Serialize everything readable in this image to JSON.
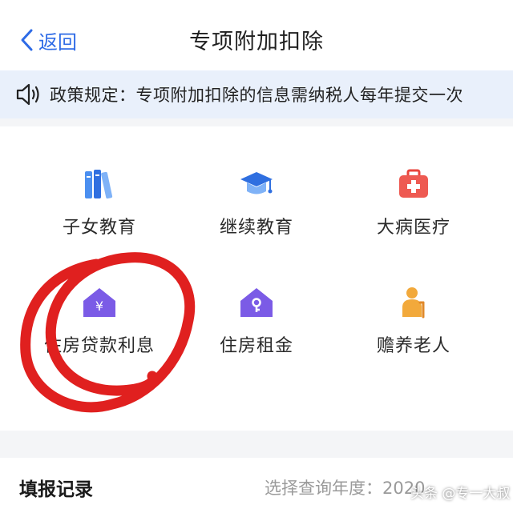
{
  "nav": {
    "back_label": "返回",
    "title": "专项附加扣除"
  },
  "notice": {
    "text": "政策规定：专项附加扣除的信息需纳税人每年提交一次"
  },
  "items": [
    {
      "label": "子女教育"
    },
    {
      "label": "继续教育"
    },
    {
      "label": "大病医疗"
    },
    {
      "label": "住房贷款利息"
    },
    {
      "label": "住房租金"
    },
    {
      "label": "赡养老人"
    }
  ],
  "records": {
    "title": "填报记录",
    "year_label": "选择查询年度：",
    "year_value": "2020"
  },
  "watermark": "头条 @专一大叔",
  "colors": {
    "accent": "#2e6be6",
    "notice_bg": "#e9f0fb",
    "annotation_red": "#e0201f"
  }
}
